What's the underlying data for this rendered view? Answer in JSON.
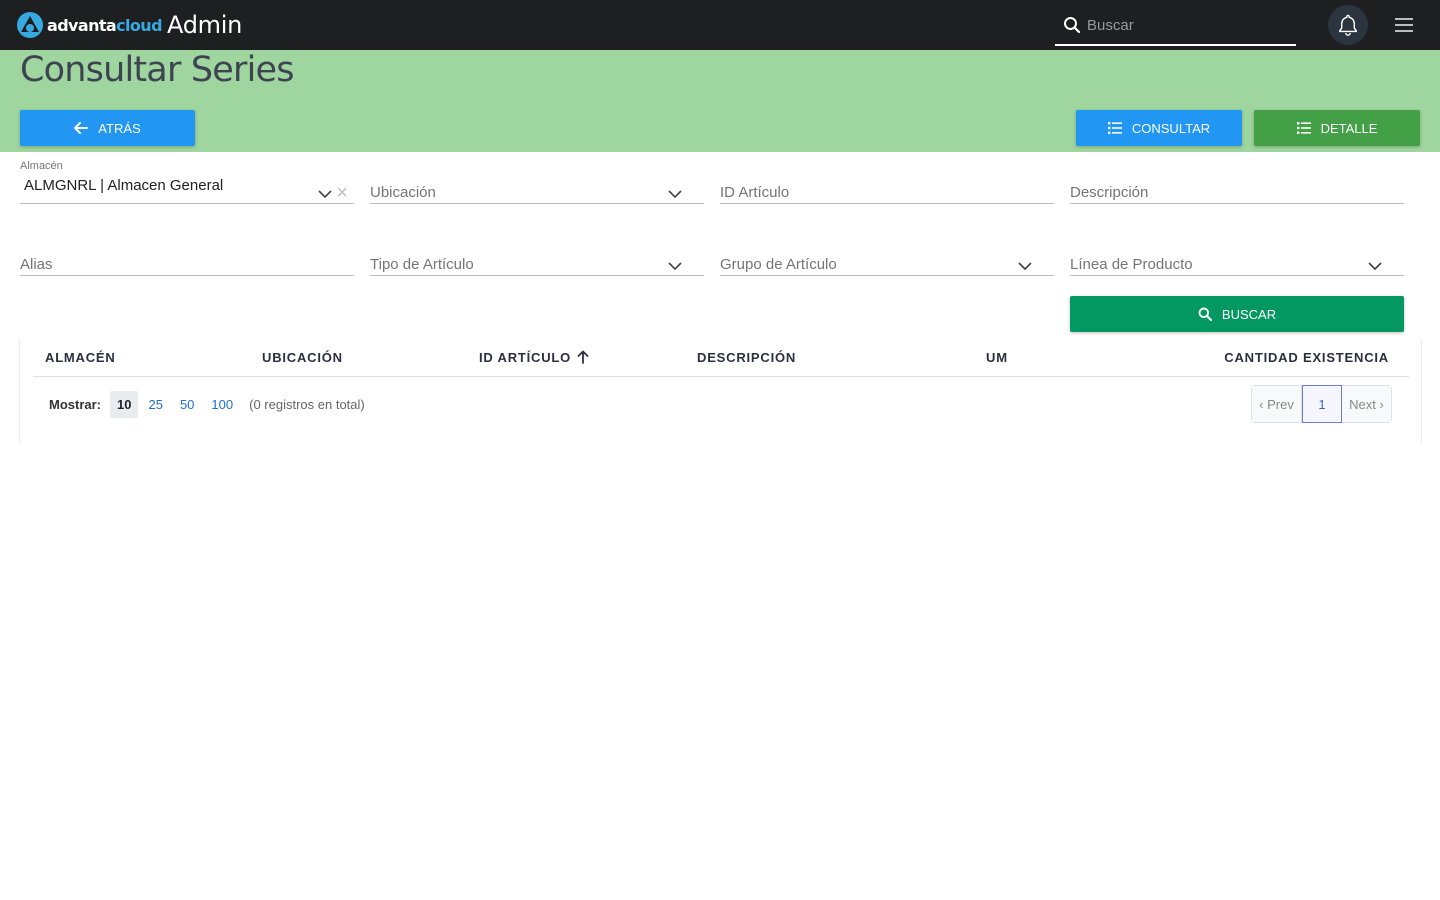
{
  "topbar": {
    "logo_text_a": "advanta",
    "logo_text_b": "cloud",
    "app_title": "Admin",
    "search_placeholder": "Buscar"
  },
  "header": {
    "title": "Consultar Series",
    "back_label": "ATRÁS",
    "consultar_label": "CONSULTAR",
    "detalle_label": "DETALLE"
  },
  "filters": {
    "almacen_label": "Almacén",
    "almacen_value": "ALMGNRL | Almacen General",
    "ubicacion_placeholder": "Ubicación",
    "id_articulo_placeholder": "ID Artículo",
    "descripcion_placeholder": "Descripción",
    "alias_placeholder": "Alias",
    "tipo_articulo_placeholder": "Tipo de Artículo",
    "grupo_articulo_placeholder": "Grupo de Artículo",
    "linea_producto_placeholder": "Línea de Producto",
    "buscar_label": "BUSCAR"
  },
  "table": {
    "columns": [
      "ALMACÉN",
      "UBICACIÓN",
      "ID ARTÍCULO",
      "DESCRIPCIÓN",
      "UM",
      "CANTIDAD EXISTENCIA"
    ],
    "sorted_column": "ID ARTÍCULO",
    "rows": [],
    "show_label": "Mostrar:",
    "page_sizes": [
      "10",
      "25",
      "50",
      "100"
    ],
    "active_page_size": "10",
    "total_text": "(0 registros en total)",
    "pager": {
      "prev": "‹ Prev",
      "current": "1",
      "next": "Next ›"
    }
  },
  "colors": {
    "topbar": "#1e1f21",
    "band": "#9fd59f",
    "primary_blue": "#2196f3",
    "detalle_green": "#43a047",
    "buscar_green": "#039861",
    "brand_blue": "#36a9e1"
  }
}
